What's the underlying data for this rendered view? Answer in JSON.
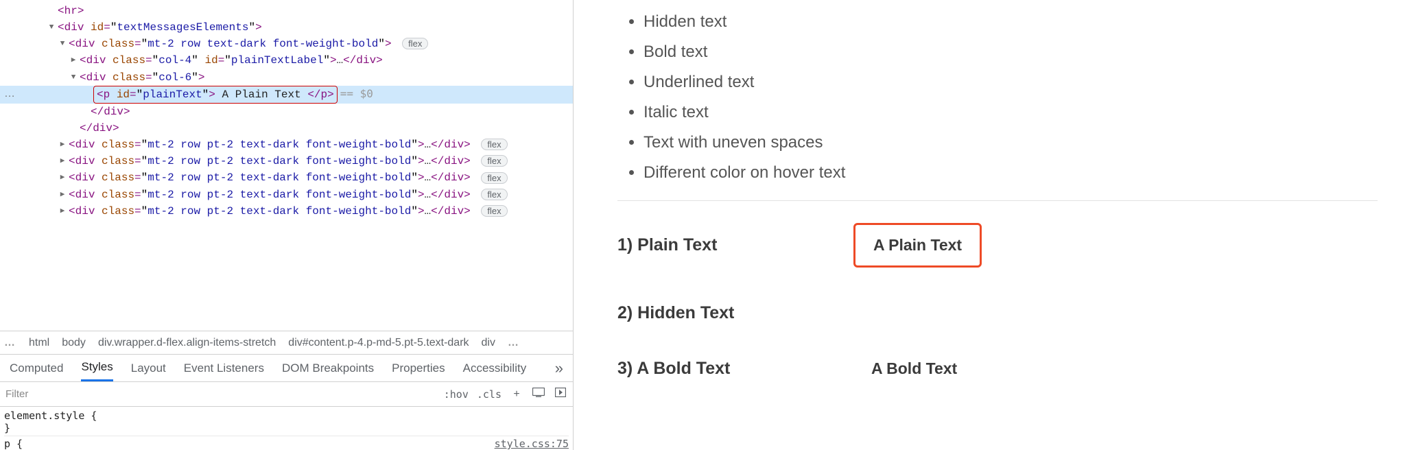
{
  "dom": {
    "hr": "<hr>",
    "div_textMessages_open": {
      "tag": "div",
      "attr_id": "id",
      "id_val": "textMessagesElements"
    },
    "div_row_open": {
      "tag": "div",
      "attr_class": "class",
      "class_val": "mt-2 row text-dark font-weight-bold",
      "badge": "flex"
    },
    "div_plainLabel": {
      "tag": "div",
      "attr_class": "class",
      "class_val": "col-4",
      "attr_id": "id",
      "id_val": "plainTextLabel",
      "close": "</div>"
    },
    "div_col6_open": {
      "tag": "div",
      "attr_class": "class",
      "class_val": "col-6"
    },
    "p_plain": {
      "tag": "p",
      "attr_id": "id",
      "id_val": "plainText",
      "text": " A Plain Text ",
      "close": "</p>",
      "eq0": "== $0"
    },
    "close_div": "</div>",
    "collapsed_row": {
      "tag": "div",
      "attr_class": "class",
      "class_val": "mt-2 row pt-2 text-dark font-weight-bold",
      "ellipsis": "…",
      "close": "</div>",
      "badge": "flex"
    }
  },
  "breadcrumb": {
    "more_left": "…",
    "items": [
      "html",
      "body",
      "div.wrapper.d-flex.align-items-stretch",
      "div#content.p-4.p-md-5.pt-5.text-dark",
      "div"
    ],
    "more_right": "…"
  },
  "tabs": {
    "computed": "Computed",
    "styles": "Styles",
    "layout": "Layout",
    "events": "Event Listeners",
    "dombp": "DOM Breakpoints",
    "props": "Properties",
    "a11y": "Accessibility",
    "more": "»"
  },
  "filter": {
    "placeholder": "Filter",
    "hov": ":hov",
    "cls": ".cls",
    "plus": "+"
  },
  "styles_rules": {
    "element_style": "element.style {",
    "close_brace": "}",
    "p_sel": "p {",
    "file_link": "style.css:75"
  },
  "preview": {
    "list": {
      "hidden": "Hidden text",
      "bold": "Bold text",
      "underlined": "Underlined text",
      "italic": "Italic text",
      "uneven": "Text with uneven spaces",
      "hovercolor": "Different color on hover text"
    },
    "rows": {
      "r1_label": "1) Plain Text",
      "r1_value": "A Plain Text",
      "r2_label": "2) Hidden Text",
      "r3_label": "3) A Bold Text",
      "r3_value": "A Bold Text"
    }
  }
}
